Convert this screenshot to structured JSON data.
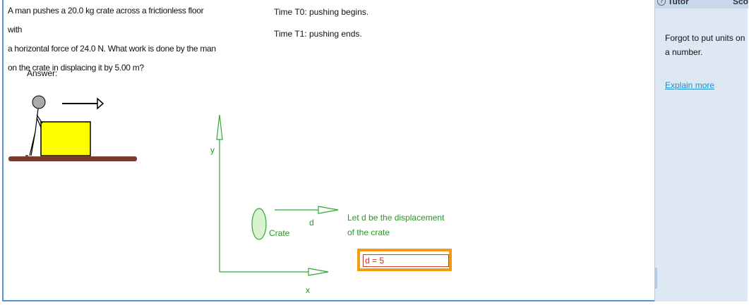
{
  "problem": {
    "lines": [
      "A man pushes a 20.0 kg crate across a frictionless floor with",
      "a horizontal force of 24.0 N. What work is done by the man",
      "on the crate in displacing it by 5.00 m?"
    ],
    "answer_label": "Answer:"
  },
  "timeline": {
    "t0": "Time T0: pushing begins.",
    "t1": "Time T1: pushing ends."
  },
  "diagram": {
    "y_label": "y",
    "x_label": "x",
    "crate_label": "Crate",
    "d_label": "d",
    "note_line1": "Let d be the displacement",
    "note_line2": "of the crate",
    "color": "#2eaa2e"
  },
  "input": {
    "value": "d = 5",
    "border_color": "#f39c12"
  },
  "sidebar": {
    "tab_tutor": "Tutor",
    "tab_score": "Scor",
    "feedback": "Forgot to put units on a number.",
    "explain_link": "Explain more"
  }
}
